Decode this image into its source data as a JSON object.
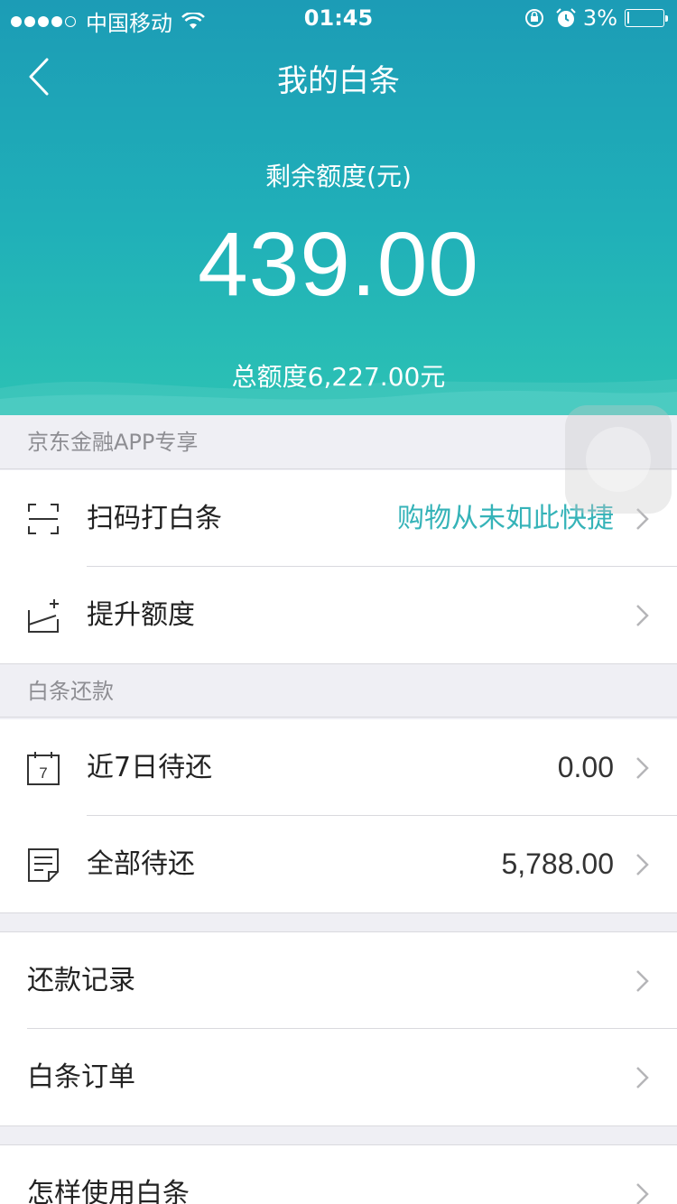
{
  "status_bar": {
    "carrier": "中国移动",
    "time": "01:45",
    "battery_percent": "3%"
  },
  "nav": {
    "title": "我的白条"
  },
  "credit": {
    "remain_label": "剩余额度(元)",
    "remain_amount": "439.00",
    "total_label": "总额度6,227.00元"
  },
  "section_jd": {
    "title": "京东金融APP专享",
    "items": [
      {
        "label": "扫码打白条",
        "value": "购物从未如此快捷",
        "icon": "scan-icon"
      },
      {
        "label": "提升额度",
        "value": "",
        "icon": "raise-limit-icon"
      }
    ]
  },
  "section_repay": {
    "title": "白条还款",
    "items": [
      {
        "label": "近7日待还",
        "value": "0.00",
        "icon": "calendar-7-icon",
        "calendar_day": "7"
      },
      {
        "label": "全部待还",
        "value": "5,788.00",
        "icon": "document-icon"
      }
    ]
  },
  "section_records": {
    "items": [
      {
        "label": "还款记录"
      },
      {
        "label": "白条订单"
      }
    ]
  },
  "section_help": {
    "items": [
      {
        "label": "怎样使用白条"
      }
    ]
  },
  "colors": {
    "header_top": "#1c9cb6",
    "header_bottom": "#2cc2b4",
    "accent_text": "#35b3b8"
  }
}
